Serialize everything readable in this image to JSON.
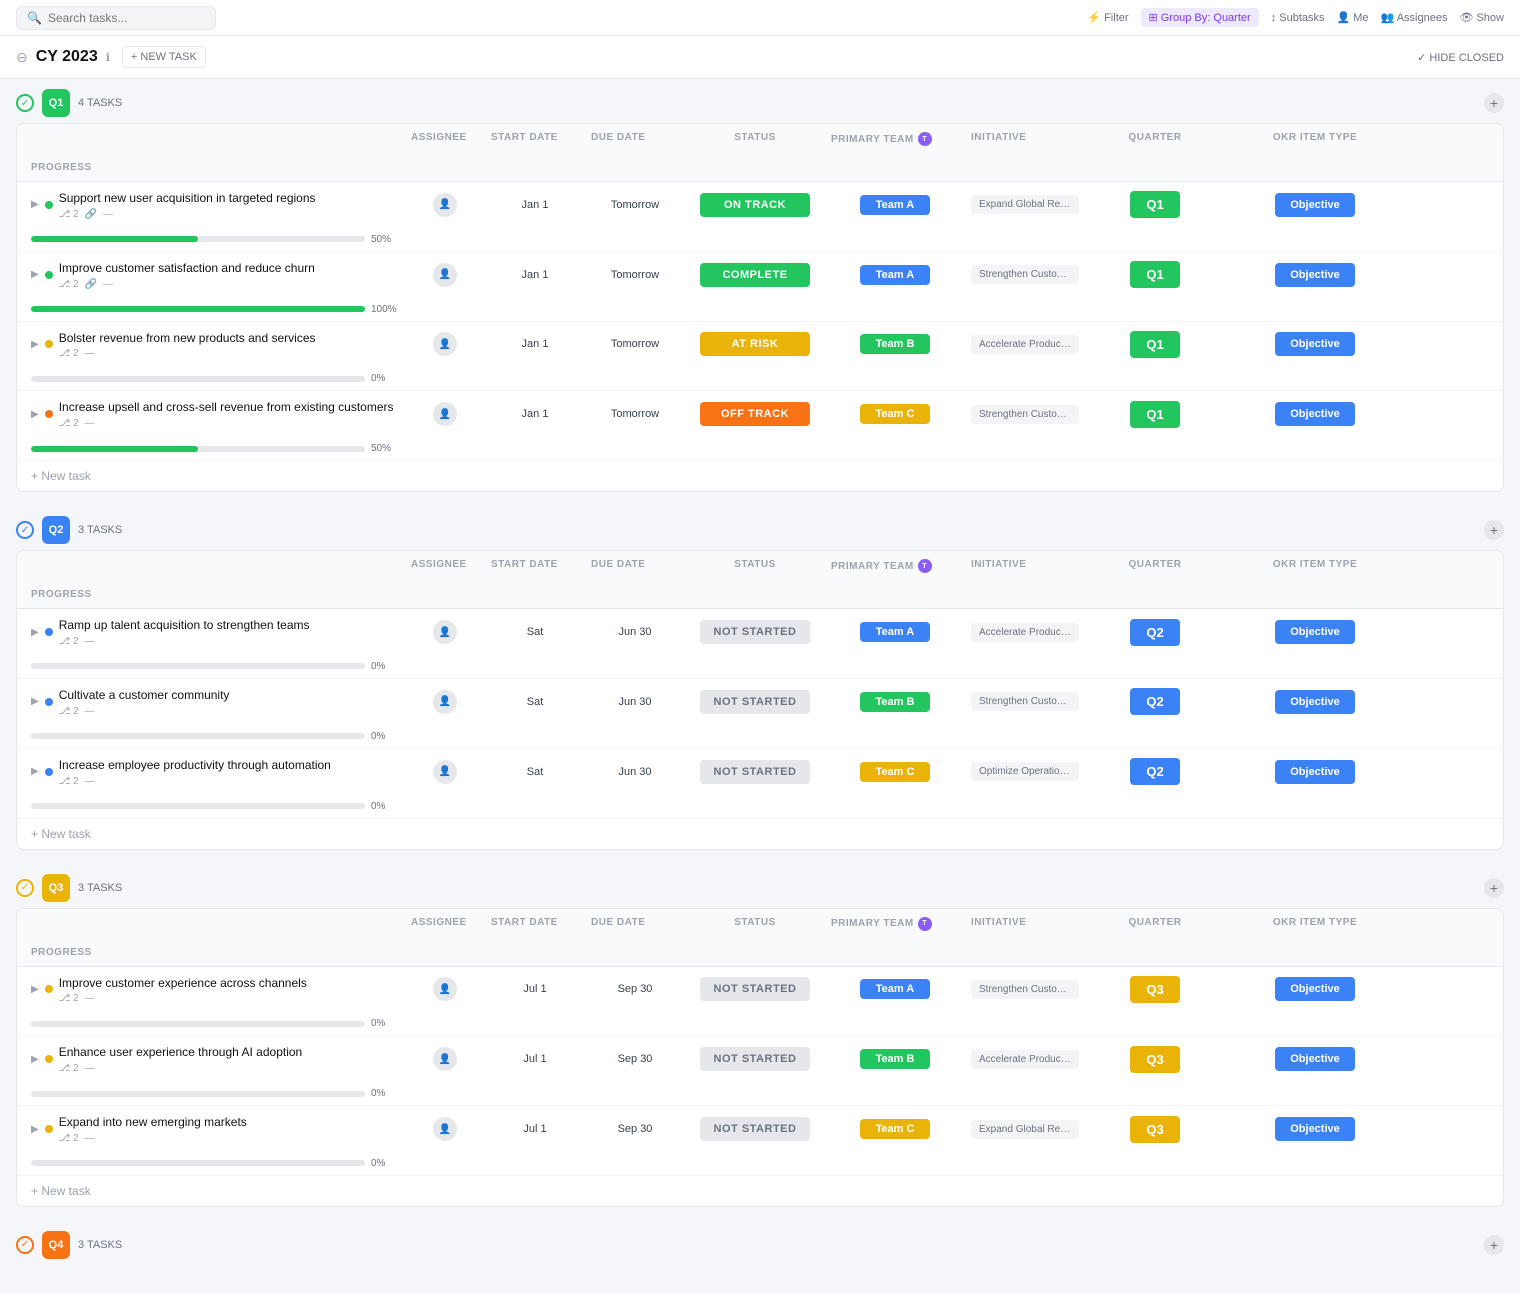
{
  "topbar": {
    "search_placeholder": "Search tasks...",
    "actions": [
      "Filter",
      "Group By: Quarter",
      "Subtasks",
      "Me",
      "Assignees",
      "Show"
    ]
  },
  "page": {
    "title": "CY 2023",
    "new_task_label": "+ NEW TASK",
    "hide_closed_label": "✓ HIDE CLOSED"
  },
  "columns": {
    "task": "",
    "assignee": "ASSIGNEE",
    "start_date": "START DATE",
    "due_date": "DUE DATE",
    "status": "STATUS",
    "primary_team": "PRIMARY TEAM",
    "initiative": "INITIATIVE",
    "quarter": "QUARTER",
    "okr_item_type": "OKR ITEM TYPE",
    "progress": "PROGRESS"
  },
  "quarters": [
    {
      "id": "Q1",
      "label": "Q1",
      "task_count": "4 TASKS",
      "color_class": "q1",
      "tasks": [
        {
          "name": "Support new user acquisition in targeted regions",
          "subtask_count": "2",
          "has_link": true,
          "dot_color": "green",
          "start_date": "Jan 1",
          "due_date": "Tomorrow",
          "status": "ON TRACK",
          "status_class": "on-track",
          "primary_team": "Team A",
          "team_class": "team-a",
          "initiative": "Expand Global Research",
          "quarter": "Q1",
          "quarter_class": "q1-cell",
          "okr_type": "Objective",
          "progress": 50
        },
        {
          "name": "Improve customer satisfaction and reduce churn",
          "subtask_count": "2",
          "has_link": true,
          "dot_color": "green",
          "start_date": "Jan 1",
          "due_date": "Tomorrow",
          "status": "COMPLETE",
          "status_class": "complete",
          "primary_team": "Team A",
          "team_class": "team-a",
          "initiative": "Strengthen Customer Retenti...",
          "quarter": "Q1",
          "quarter_class": "q1-cell",
          "okr_type": "Objective",
          "progress": 100
        },
        {
          "name": "Bolster revenue from new products and services",
          "subtask_count": "2",
          "has_link": false,
          "dot_color": "yellow",
          "start_date": "Jan 1",
          "due_date": "Tomorrow",
          "status": "AT RISK",
          "status_class": "at-risk",
          "primary_team": "Team B",
          "team_class": "team-b",
          "initiative": "Accelerate Product Innovation",
          "quarter": "Q1",
          "quarter_class": "q1-cell",
          "okr_type": "Objective",
          "progress": 0
        },
        {
          "name": "Increase upsell and cross-sell revenue from existing customers",
          "subtask_count": "2",
          "has_link": false,
          "dot_color": "orange",
          "start_date": "Jan 1",
          "due_date": "Tomorrow",
          "status": "OFF TRACK",
          "status_class": "off-track",
          "primary_team": "Team C",
          "team_class": "team-c",
          "initiative": "Strengthen Customer Retenti...",
          "quarter": "Q1",
          "quarter_class": "q1-cell",
          "okr_type": "Objective",
          "progress": 50
        }
      ]
    },
    {
      "id": "Q2",
      "label": "Q2",
      "task_count": "3 TASKS",
      "color_class": "q2",
      "tasks": [
        {
          "name": "Ramp up talent acquisition to strengthen teams",
          "subtask_count": "2",
          "has_link": false,
          "dot_color": "blue",
          "start_date": "Sat",
          "due_date": "Jun 30",
          "status": "NOT STARTED",
          "status_class": "not-started",
          "primary_team": "Team A",
          "team_class": "team-a",
          "initiative": "Accelerate Product Innovation",
          "quarter": "Q2",
          "quarter_class": "q2-cell",
          "okr_type": "Objective",
          "progress": 0
        },
        {
          "name": "Cultivate a customer community",
          "subtask_count": "2",
          "has_link": false,
          "dot_color": "blue",
          "start_date": "Sat",
          "due_date": "Jun 30",
          "status": "NOT STARTED",
          "status_class": "not-started",
          "primary_team": "Team B",
          "team_class": "team-b",
          "initiative": "Strengthen Customer Retenti...",
          "quarter": "Q2",
          "quarter_class": "q2-cell",
          "okr_type": "Objective",
          "progress": 0
        },
        {
          "name": "Increase employee productivity through automation",
          "subtask_count": "2",
          "has_link": false,
          "dot_color": "blue",
          "start_date": "Sat",
          "due_date": "Jun 30",
          "status": "NOT STARTED",
          "status_class": "not-started",
          "primary_team": "Team C",
          "team_class": "team-c",
          "initiative": "Optimize Operational Efficien...",
          "quarter": "Q2",
          "quarter_class": "q2-cell",
          "okr_type": "Objective",
          "progress": 0
        }
      ]
    },
    {
      "id": "Q3",
      "label": "Q3",
      "task_count": "3 TASKS",
      "color_class": "q3",
      "tasks": [
        {
          "name": "Improve customer experience across channels",
          "subtask_count": "2",
          "has_link": false,
          "dot_color": "yellow",
          "start_date": "Jul 1",
          "due_date": "Sep 30",
          "status": "NOT STARTED",
          "status_class": "not-started",
          "primary_team": "Team A",
          "team_class": "team-a",
          "initiative": "Strengthen Customer Retenti...",
          "quarter": "Q3",
          "quarter_class": "q3-cell",
          "okr_type": "Objective",
          "progress": 0
        },
        {
          "name": "Enhance user experience through AI adoption",
          "subtask_count": "2",
          "has_link": false,
          "dot_color": "yellow",
          "start_date": "Jul 1",
          "due_date": "Sep 30",
          "status": "NOT STARTED",
          "status_class": "not-started",
          "primary_team": "Team B",
          "team_class": "team-b",
          "initiative": "Accelerate Product Innovation",
          "quarter": "Q3",
          "quarter_class": "q3-cell",
          "okr_type": "Objective",
          "progress": 0
        },
        {
          "name": "Expand into new emerging markets",
          "subtask_count": "2",
          "has_link": false,
          "dot_color": "yellow",
          "start_date": "Jul 1",
          "due_date": "Sep 30",
          "status": "NOT STARTED",
          "status_class": "not-started",
          "primary_team": "Team C",
          "team_class": "team-c",
          "initiative": "Expand Global Research",
          "quarter": "Q3",
          "quarter_class": "q3-cell",
          "okr_type": "Objective",
          "progress": 0
        }
      ]
    },
    {
      "id": "Q4",
      "label": "Q4",
      "task_count": "3 TASKS",
      "color_class": "q4",
      "tasks": []
    }
  ],
  "new_task_label": "+ New task"
}
